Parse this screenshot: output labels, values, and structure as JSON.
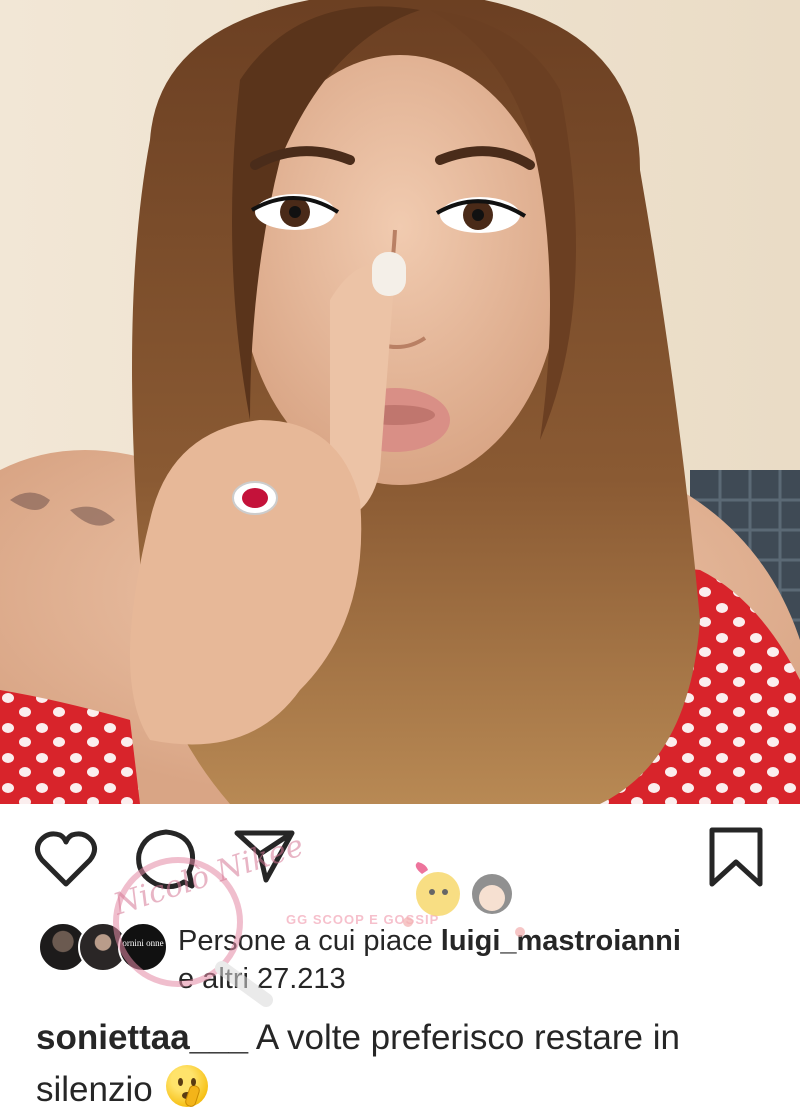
{
  "post": {
    "image_alt": "Selfie of a woman with long brown hair holding a finger to her lips, wearing a red polka-dot top and a ruby ring",
    "like_icon": "heart-outline-icon",
    "comment_icon": "comment-bubble-icon",
    "share_icon": "paper-plane-icon",
    "save_icon": "bookmark-outline-icon"
  },
  "likes": {
    "prefix": "Persone a cui piace ",
    "user": "luigi_mastroianni",
    "suffix": "e altri 27.213",
    "avatar_badge_text": "ornini onne"
  },
  "caption": {
    "user": "soniettaa___",
    "text": " A volte preferisco restare in silenzio ",
    "emoji": "shushing-face-emoji"
  },
  "watermark": {
    "text": "Nicolò Nikee",
    "sub_text": "GG SCOOP E GOSSIP"
  },
  "colors": {
    "text": "#262626",
    "icon": "#262626",
    "dress_red": "#d8242b",
    "background": "#ffffff"
  }
}
